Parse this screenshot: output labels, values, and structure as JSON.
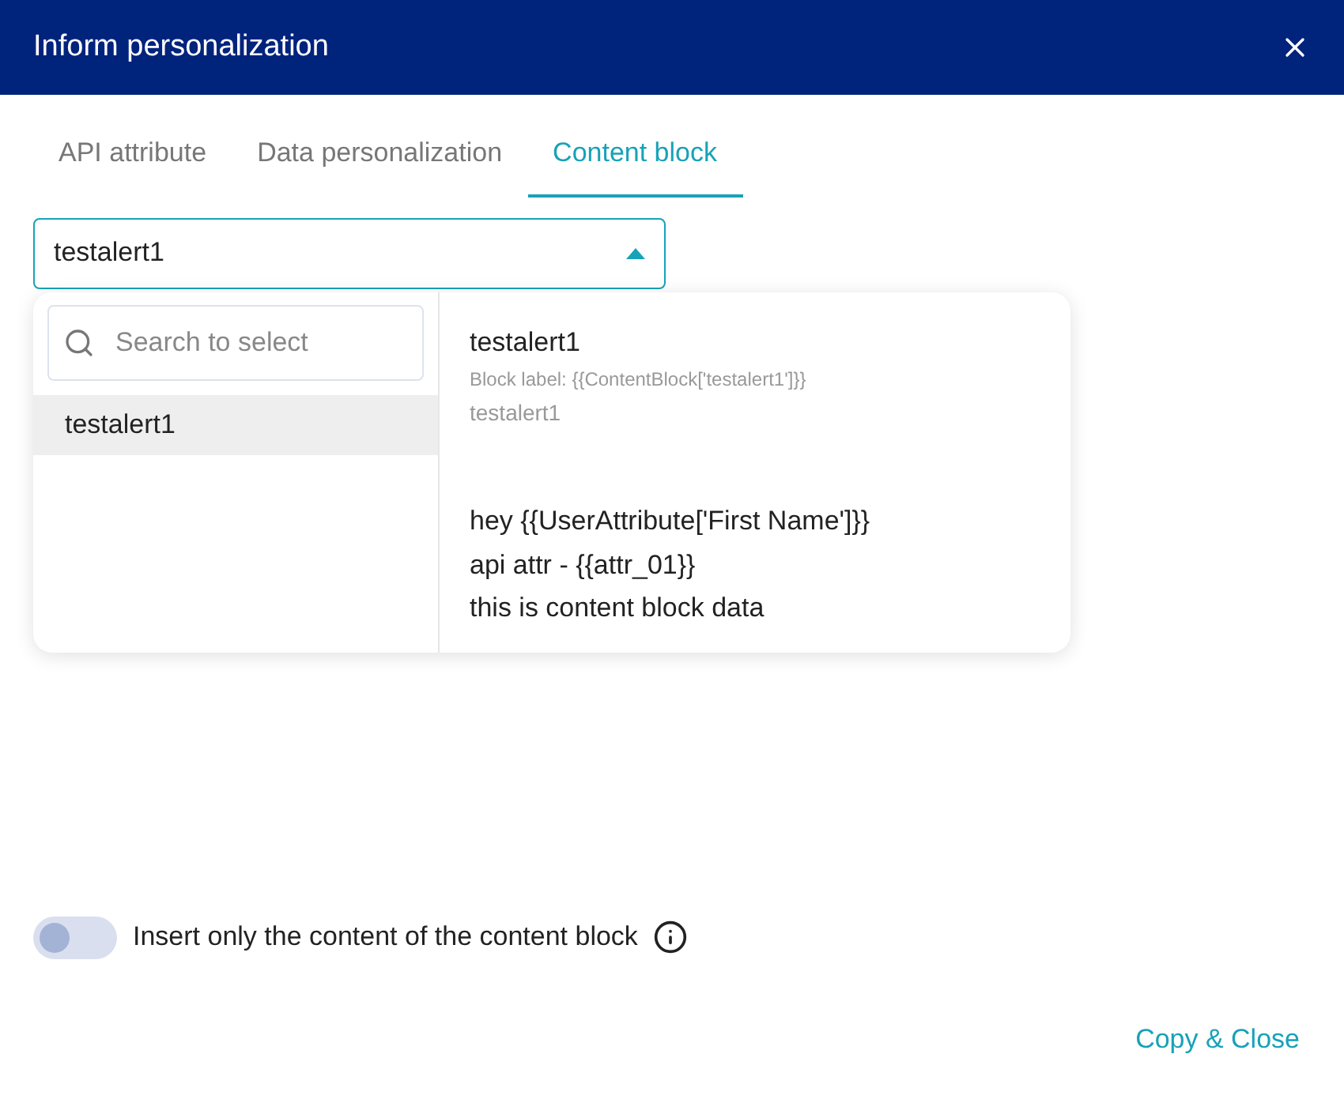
{
  "dialog": {
    "title": "Inform personalization"
  },
  "tabs": [
    {
      "label": "API attribute",
      "selected": false
    },
    {
      "label": "Data personalization",
      "selected": false
    },
    {
      "label": "Content block",
      "selected": true
    }
  ],
  "select": {
    "value": "testalert1",
    "expanded": true
  },
  "dropdown": {
    "search": {
      "placeholder": "Search to select"
    },
    "options": [
      {
        "label": "testalert1",
        "selected": true
      }
    ],
    "preview": {
      "name": "testalert1",
      "block_label": "Block label: {{ContentBlock['testalert1']}}",
      "subtitle": "testalert1",
      "content": [
        "hey {{UserAttribute['First Name']}}",
        "api attr - {{attr_01}}",
        "this is content block data"
      ]
    }
  },
  "toggle": {
    "label": "Insert only the content of the content block",
    "on": false
  },
  "footer_button": "Copy & Close"
}
